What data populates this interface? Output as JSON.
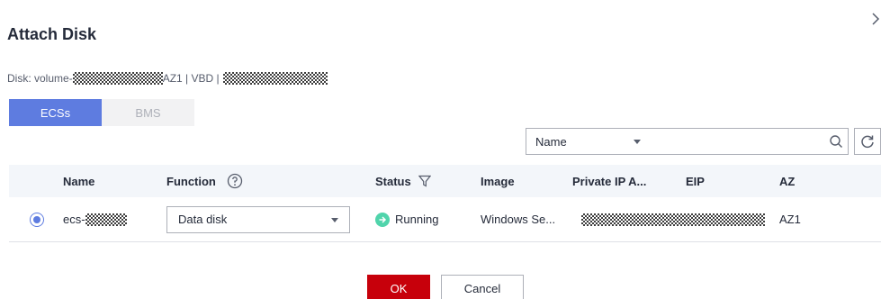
{
  "dialog": {
    "title": "Attach Disk"
  },
  "disk_info": {
    "prefix": "Disk: volume-",
    "middle": "AZ1 | VBD |"
  },
  "tabs": [
    {
      "label": "ECSs",
      "active": true
    },
    {
      "label": "BMS",
      "active": false
    }
  ],
  "filter": {
    "field": "Name",
    "value": ""
  },
  "table": {
    "headers": {
      "name": "Name",
      "function": "Function",
      "status": "Status",
      "image": "Image",
      "private_ip": "Private IP A...",
      "eip": "EIP",
      "az": "AZ"
    },
    "rows": [
      {
        "selected": true,
        "name": "ecs-",
        "function": "Data disk",
        "status": "Running",
        "image": "Windows Se...",
        "eip": "",
        "az": "AZ1"
      }
    ]
  },
  "footer": {
    "ok_label": "OK",
    "cancel_label": "Cancel"
  },
  "colors": {
    "primary": "#5e7ce0",
    "danger_button": "#c7000b",
    "running": "#50d4ab"
  }
}
